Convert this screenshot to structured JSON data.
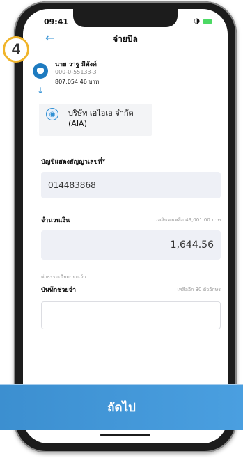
{
  "status_bar": {
    "time": "09:41"
  },
  "header": {
    "title": "จ่ายบิล",
    "step_number": "4"
  },
  "from_account": {
    "name": "นาย วาฐ มีตังค์",
    "number": "000-0-55133-3",
    "balance": "807,054.46 บาท"
  },
  "payee": {
    "name": "บริษัท เอไอเอ จำกัด",
    "code": "(AIA)"
  },
  "fields": {
    "ref_label": "บัญชีแสดงสัญญาเลขที่*",
    "ref_value": "014483868",
    "amount_label": "จำนวนเงิน",
    "amount_hint": "วงเงินคงเหลือ 49,001.00 บาท",
    "amount_value": "1,644.56",
    "fee_text": "ค่าธรรมเนียม: ยกเว้น",
    "memo_label": "บันทึกช่วยจำ",
    "memo_hint": "เหลืออีก 30 ตัวอักษร"
  },
  "footer": {
    "next_label": "ถัดไป"
  },
  "colors": {
    "accent": "#2f8fd3",
    "cta": "#4a9fe0",
    "step_ring": "#f0b429"
  }
}
